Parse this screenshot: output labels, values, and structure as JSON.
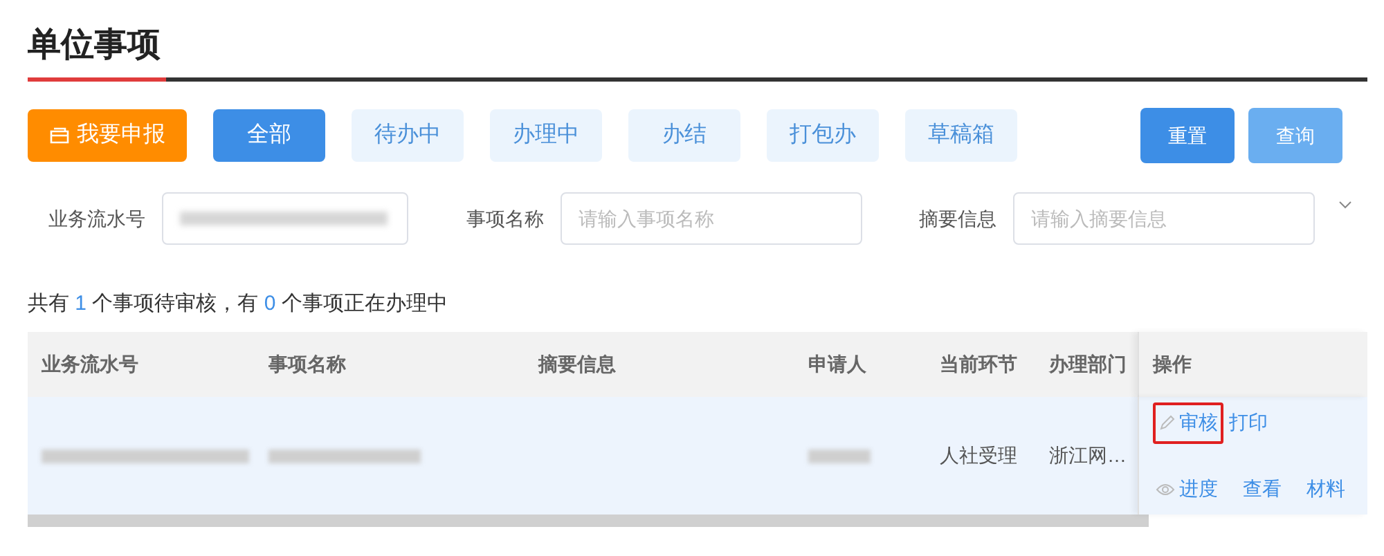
{
  "page_title": "单位事项",
  "report_button": {
    "label": "我要申报"
  },
  "tabs": [
    {
      "label": "全部",
      "selected": true
    },
    {
      "label": "待办中",
      "selected": false
    },
    {
      "label": "办理中",
      "selected": false
    },
    {
      "label": "办结",
      "selected": false
    },
    {
      "label": "打包办",
      "selected": false
    },
    {
      "label": "草稿箱",
      "selected": false
    }
  ],
  "actions": [
    {
      "label": "重置",
      "kind": "primary"
    },
    {
      "label": "查询",
      "kind": "light"
    }
  ],
  "filters": [
    {
      "label": "业务流水号",
      "redacted": true
    },
    {
      "label": "事项名称",
      "placeholder": "请输入事项名称"
    },
    {
      "label": "摘要信息",
      "placeholder": "请输入摘要信息"
    }
  ],
  "summary": [
    {
      "text": "共有 ",
      "highlight": false
    },
    {
      "text": "1",
      "highlight": true
    },
    {
      "text": " 个事项待审核，有 ",
      "highlight": false
    },
    {
      "text": "0",
      "highlight": true
    },
    {
      "text": " 个事项正在办理中",
      "highlight": false
    }
  ],
  "table": {
    "columns": [
      "业务流水号",
      "事项名称",
      "摘要信息",
      "申请人",
      "当前环节",
      "办理部门",
      "操作"
    ],
    "rows": [
      {
        "selected": true,
        "cells": [
          {
            "redacted": true
          },
          {
            "redacted": true
          },
          {},
          {
            "redacted": true
          },
          {
            "text": "人社受理"
          },
          {
            "text": "浙江网…"
          }
        ],
        "operations": [
          [
            {
              "label": "审核",
              "kind": "edit",
              "highlighted": true
            },
            {
              "label": "打印",
              "highlighted": false
            }
          ],
          [
            {
              "label": "进度",
              "kind": "progress",
              "highlighted": false
            },
            {
              "label": "查看",
              "highlighted": false
            },
            {
              "label": "材料",
              "highlighted": false
            }
          ]
        ]
      }
    ]
  }
}
